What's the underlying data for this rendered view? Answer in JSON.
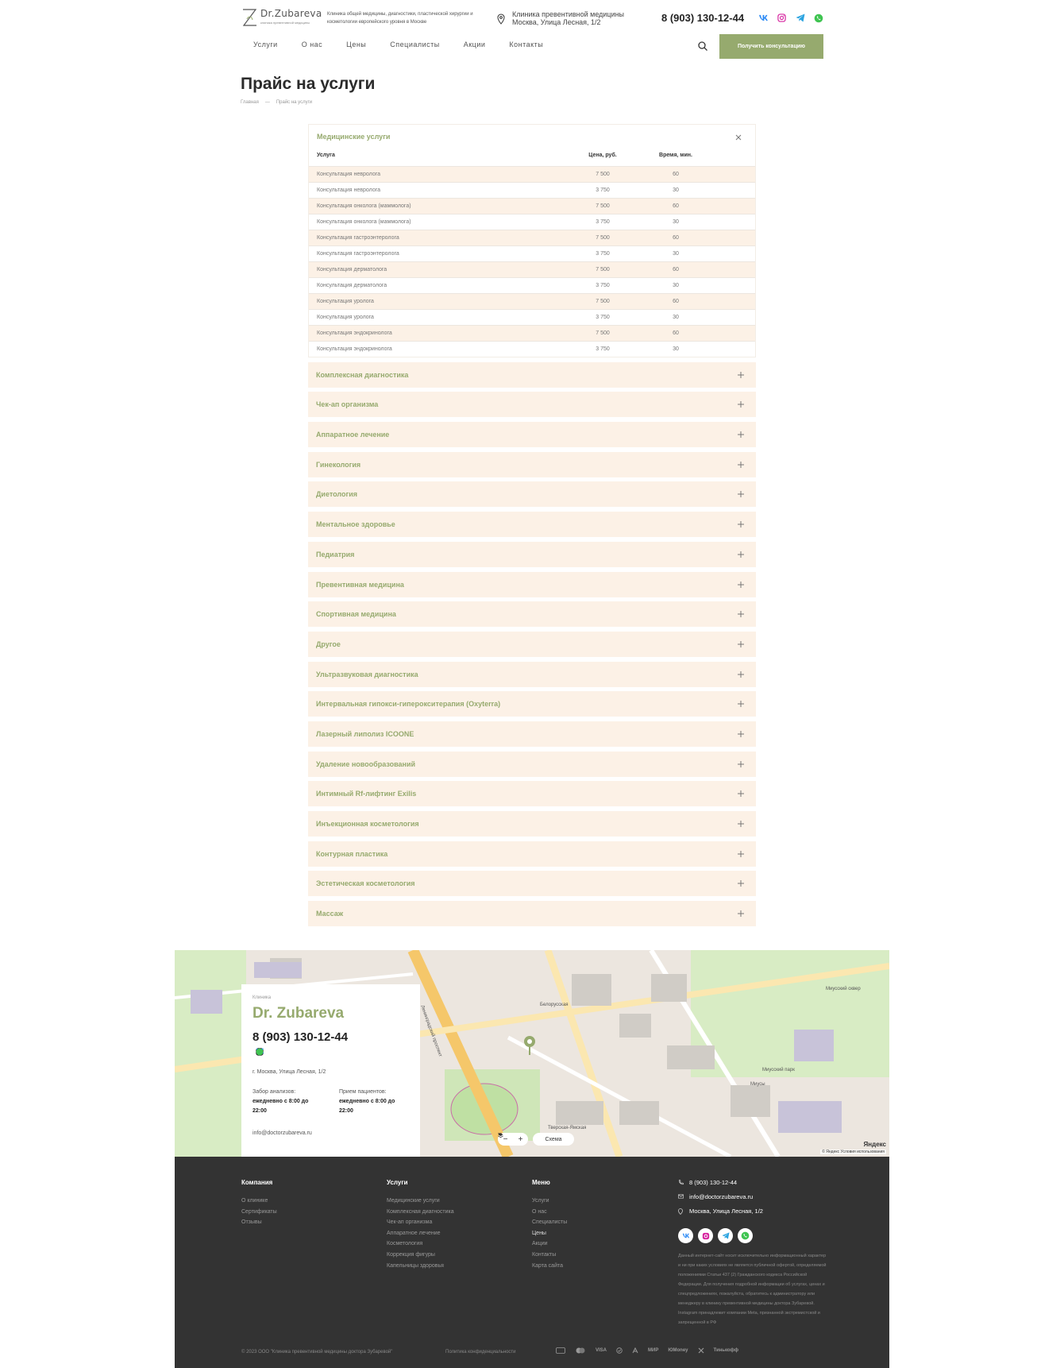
{
  "header": {
    "logo_text": "Dr.Zubareva",
    "logo_sub": "клиника превентивной медицины",
    "tagline": "Клиника общей медицины, диагностики, пластической хирургии и косметологии европейского уровня в Москве",
    "clinic_name": "Клиника превентивной медицины",
    "address": "Москва, Улица Лесная, 1/2",
    "phone": "8 (903) 130-12-44",
    "social": [
      "vk-icon",
      "instagram-icon",
      "telegram-icon",
      "whatsapp-icon"
    ],
    "nav": [
      "Услуги",
      "О нас",
      "Цены",
      "Специалисты",
      "Акции",
      "Контакты"
    ],
    "cta": "Получить консультацию"
  },
  "page": {
    "title": "Прайс на услуги",
    "breadcrumb": [
      "Главная",
      "—",
      "Прайс на услуги"
    ]
  },
  "open_section": {
    "title": "Медицинские услуги",
    "columns": [
      "Услуга",
      "Цена, руб.",
      "Время, мин."
    ],
    "rows": [
      [
        "Консультация невролога",
        "7 500",
        "60"
      ],
      [
        "Консультация невролога",
        "3 750",
        "30"
      ],
      [
        "Консультация онколога (маммолога)",
        "7 500",
        "60"
      ],
      [
        "Консультация онколога (маммолога)",
        "3 750",
        "30"
      ],
      [
        "Консультация гастроэнтеролога",
        "7 500",
        "60"
      ],
      [
        "Консультация гастроэнтеролога",
        "3 750",
        "30"
      ],
      [
        "Консультация дерматолога",
        "7 500",
        "60"
      ],
      [
        "Консультация дерматолога",
        "3 750",
        "30"
      ],
      [
        "Консультация уролога",
        "7 500",
        "60"
      ],
      [
        "Консультация уролога",
        "3 750",
        "30"
      ],
      [
        "Консультация эндокринолога",
        "7 500",
        "60"
      ],
      [
        "Консультация эндокринолога",
        "3 750",
        "30"
      ]
    ]
  },
  "sections": [
    "Комплексная диагностика",
    "Чек-ап организма",
    "Аппаратное лечение",
    "Гинекология",
    "Диетология",
    "Ментальное здоровье",
    "Педиатрия",
    "Превентивная медицина",
    "Спортивная медицина",
    "Другое",
    "Ультразвуковая диагностика",
    "Интервальная гипокси-гиперокситерапия (Oxyterra)",
    "Лазерный липолиз ICOONE",
    "Удаление новообразований",
    "Интимный Rf-лифтинг Exilis",
    "Инъекционная косметология",
    "Контурная пластика",
    "Эстетическая косметология",
    "Массаж"
  ],
  "map_card": {
    "label": "Клиника",
    "name": "Dr. Zubareva",
    "phone": "8 (903) 130-12-44",
    "address": "г. Москва, Улица Лесная, 1/2",
    "hours1_label": "Забор анализов:",
    "hours1_value": "ежедневно с 8:00 до 22:00",
    "hours2_label": "Прием пациентов:",
    "hours2_value": "ежедневно с 8:00 до 22:00",
    "email": "info@doctorzubareva.ru",
    "zoom_minus": "−",
    "zoom_plus": "+",
    "scheme": "Схема",
    "brand": "Яндекс",
    "attribution": "© Яндекс  Условия использования",
    "labels": [
      "Белорусская",
      "Миусский сквер",
      "Миусы",
      "Миусский парк",
      "Тверская-Ямская",
      "Ленинградский проспект"
    ]
  },
  "footer": {
    "company_title": "Компания",
    "company": [
      "О клинике",
      "Сертификаты",
      "Отзывы"
    ],
    "services_title": "Услуги",
    "services": [
      "Медицинские услуги",
      "Комплексная диагностика",
      "Чек-ап организма",
      "Аппаратное лечение",
      "Косметология",
      "Коррекция фигуры",
      "Капельницы здоровья"
    ],
    "menu_title": "Меню",
    "menu": [
      "Услуги",
      "О нас",
      "Специалисты",
      "Цены",
      "Акции",
      "Контакты",
      "Карта сайта"
    ],
    "phone": "8 (903) 130-12-44",
    "email": "info@doctorzubareva.ru",
    "address": "Москва, Улица Лесная, 1/2",
    "disclaimer": "Данный интернет-сайт носит исключительно информационный характер и ни при каких условиях не является публичной офертой, определяемой положениями Статьи 437 (2) Гражданского кодекса Российской Федерации. Для получения подробной информации об услугах, ценах и спецпредложениях, пожалуйста, обратитесь к администратору или менеджеру в клинику превентивной медицины доктора Зубаревой. Instagram принадлежит компании Meta, признанной экстремистской и запрещенной в РФ",
    "copyright": "© 2023 ООО \"Клиника превентивной медицины доктора Зубаревой\"",
    "policy": "Политика конфиденциальности",
    "payments": [
      "Mastercard",
      "VISA",
      "МИР",
      "ЮMoney",
      "Тинькофф"
    ]
  },
  "colors": {
    "accent": "#96aa6e",
    "row_tint": "#fcf1e6",
    "footer_bg": "#333333"
  }
}
